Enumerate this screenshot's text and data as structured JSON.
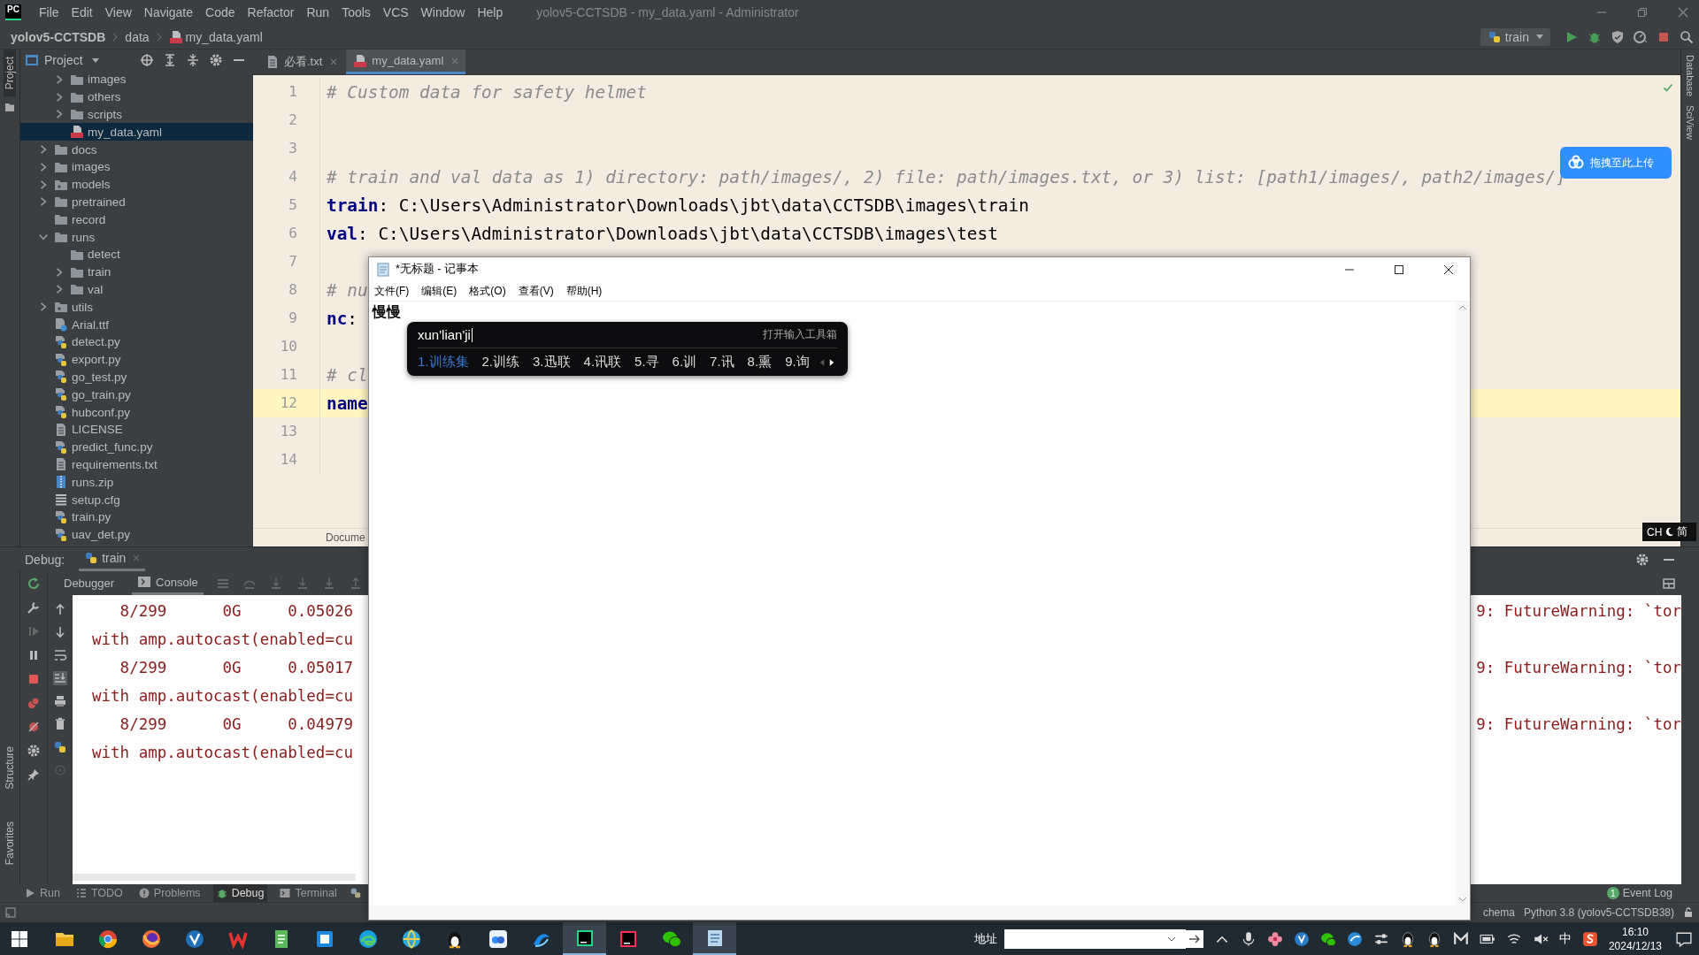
{
  "ide": {
    "logo": "PC",
    "menu": [
      "File",
      "Edit",
      "View",
      "Navigate",
      "Code",
      "Refactor",
      "Run",
      "Tools",
      "VCS",
      "Window",
      "Help"
    ],
    "window_title": "yolov5-CCTSDB - my_data.yaml - Administrator",
    "breadcrumbs": [
      {
        "label": "yolov5-CCTSDB",
        "kind": "project"
      },
      {
        "label": "data",
        "kind": "folder"
      },
      {
        "label": "my_data.yaml",
        "kind": "yaml"
      }
    ],
    "run_config": "train",
    "left_stripe": [
      "Project"
    ],
    "project_panel": {
      "title": "Project",
      "tree": [
        {
          "children": [
            {
              "name": "images",
              "kind": "folder",
              "expanded": false,
              "selected": false
            },
            {
              "name": "others",
              "kind": "folder",
              "expanded": false,
              "selected": false
            },
            {
              "name": "scripts",
              "kind": "folder",
              "expanded": false,
              "selected": false
            },
            {
              "name": "my_data.yaml",
              "kind": "yaml",
              "selected": true
            }
          ]
        },
        {
          "name": "docs",
          "kind": "folder",
          "expanded": false,
          "selected": false
        },
        {
          "name": "images",
          "kind": "folder",
          "expanded": false,
          "selected": false
        },
        {
          "name": "models",
          "kind": "package",
          "expanded": false,
          "selected": false
        },
        {
          "name": "pretrained",
          "kind": "folder",
          "expanded": false,
          "selected": false
        },
        {
          "name": "record",
          "kind": "folder",
          "selected": false
        },
        {
          "name": "runs",
          "kind": "folder",
          "expanded": true,
          "selected": false,
          "children": [
            {
              "name": "detect",
              "kind": "folder",
              "selected": false
            },
            {
              "name": "train",
              "kind": "folder",
              "expanded": false,
              "selected": false
            },
            {
              "name": "val",
              "kind": "folder",
              "expanded": false,
              "selected": false
            }
          ]
        },
        {
          "name": "utils",
          "kind": "package",
          "expanded": false,
          "selected": false
        },
        {
          "name": "Arial.ttf",
          "kind": "font",
          "selected": false
        },
        {
          "name": "detect.py",
          "kind": "py",
          "selected": false
        },
        {
          "name": "export.py",
          "kind": "py",
          "selected": false
        },
        {
          "name": "go_test.py",
          "kind": "py",
          "selected": false
        },
        {
          "name": "go_train.py",
          "kind": "py",
          "selected": false
        },
        {
          "name": "hubconf.py",
          "kind": "py",
          "selected": false
        },
        {
          "name": "LICENSE",
          "kind": "text",
          "selected": false
        },
        {
          "name": "predict_func.py",
          "kind": "py",
          "selected": false
        },
        {
          "name": "requirements.txt",
          "kind": "text",
          "selected": false
        },
        {
          "name": "runs.zip",
          "kind": "zip",
          "selected": false
        },
        {
          "name": "setup.cfg",
          "kind": "cfg",
          "selected": false
        },
        {
          "name": "train.py",
          "kind": "py",
          "selected": false
        },
        {
          "name": "uav_det.py",
          "kind": "py",
          "selected": false
        }
      ]
    },
    "editor_tabs": [
      {
        "label": "必看.txt",
        "kind": "text",
        "selected": false
      },
      {
        "label": "my_data.yaml",
        "kind": "yaml",
        "selected": true
      }
    ],
    "editor_lines": [
      {
        "number": "1",
        "kind": "comment",
        "text": "# Custom data for safety helmet",
        "current": false
      },
      {
        "number": "2",
        "current": false
      },
      {
        "number": "3",
        "current": false
      },
      {
        "number": "4",
        "kind": "comment",
        "text": "# train and val data as 1) directory: path/images/, 2) file: path/images.txt, or 3) list: [path1/images/, path2/images/]",
        "current": false
      },
      {
        "number": "5",
        "kind": "pair",
        "key": "train",
        "rest": ": C:\\Users\\Administrator\\Downloads\\jbt\\data\\CCTSDB\\images\\train",
        "current": false
      },
      {
        "number": "6",
        "kind": "pair",
        "key": "val",
        "rest": ": C:\\Users\\Administrator\\Downloads\\jbt\\data\\CCTSDB\\images\\test",
        "current": false
      },
      {
        "number": "7",
        "current": false
      },
      {
        "number": "8",
        "kind": "comment",
        "text": "# nu",
        "current": false
      },
      {
        "number": "9",
        "kind": "pair",
        "key": "nc",
        "rest": ":",
        "current": false
      },
      {
        "number": "10",
        "current": false
      },
      {
        "number": "11",
        "kind": "comment",
        "text": "# cl",
        "current": false
      },
      {
        "number": "12",
        "kind": "pair",
        "key": "name",
        "current": true
      },
      {
        "number": "13",
        "current": false
      },
      {
        "number": "14",
        "current": false
      }
    ],
    "editor_breadcrumb": "Docume",
    "right_stripe": [
      "Database",
      "SciView"
    ],
    "upload_badge": "拖拽至此上传",
    "debug": {
      "title": "Debug:",
      "session": "train",
      "tabs": [
        {
          "label": "Debugger",
          "selected": false
        },
        {
          "label": "Console",
          "selected": true
        }
      ],
      "console": [
        {
          "left": "   8/299      0G     0.05026",
          "right": "9: FutureWarning: `tor"
        },
        {
          "left": "with amp.autocast(enabled=cu"
        },
        {
          "left": "   8/299      0G     0.05017",
          "right": "9: FutureWarning: `tor"
        },
        {
          "left": "with amp.autocast(enabled=cu"
        },
        {
          "left": "   8/299      0G     0.04979",
          "right": "9: FutureWarning: `tor"
        },
        {
          "left": "with amp.autocast(enabled=cu"
        }
      ]
    },
    "side_tabs": [
      "Structure",
      "Favorites"
    ],
    "tool_tabs": [
      {
        "label": "Run",
        "kind": "run",
        "selected": false
      },
      {
        "label": "TODO",
        "kind": "todo",
        "selected": false
      },
      {
        "label": "Problems",
        "kind": "problems",
        "selected": false
      },
      {
        "label": "Debug",
        "kind": "debug",
        "selected": true
      },
      {
        "label": "Terminal",
        "kind": "terminal",
        "selected": false
      }
    ],
    "event_log": {
      "count": "1",
      "label": "Event Log"
    },
    "status": [
      "chema",
      "Python 3.8 (yolov5-CCTSDB38)"
    ]
  },
  "ime_indicator": {
    "language": "CH",
    "mode": "简"
  },
  "notepad": {
    "title": "*无标题 - 记事本",
    "menu": [
      "文件(F)",
      "编辑(E)",
      "格式(O)",
      "查看(V)",
      "帮助(H)"
    ],
    "content": "慢慢",
    "ime": {
      "composition": "xun'lian'ji",
      "toolbox": "打开输入工具箱",
      "candidates": [
        {
          "label": "1.训练集",
          "selected": true
        },
        {
          "label": "2.训练",
          "selected": false
        },
        {
          "label": "3.迅联",
          "selected": false
        },
        {
          "label": "4.讯联",
          "selected": false
        },
        {
          "label": "5.寻",
          "selected": false
        },
        {
          "label": "6.训",
          "selected": false
        },
        {
          "label": "7.讯",
          "selected": false
        },
        {
          "label": "8.熏",
          "selected": false
        },
        {
          "label": "9.询",
          "selected": false
        }
      ],
      "prev_enabled": false,
      "next_enabled": true
    }
  },
  "taskbar": {
    "apps": [
      {
        "kind": "explorer",
        "active": false
      },
      {
        "kind": "chrome",
        "active": false
      },
      {
        "kind": "firefox",
        "active": false
      },
      {
        "kind": "vapp",
        "active": false
      },
      {
        "kind": "wps",
        "active": false
      },
      {
        "kind": "greendoc",
        "active": false
      },
      {
        "kind": "bluesquare",
        "active": false
      },
      {
        "kind": "edge",
        "active": false
      },
      {
        "kind": "globe",
        "active": false
      },
      {
        "kind": "penguin",
        "active": false
      },
      {
        "kind": "cloud",
        "active": false
      },
      {
        "kind": "swirl",
        "active": false
      },
      {
        "kind": "pycharm",
        "active": true
      },
      {
        "kind": "intellij",
        "active": false
      },
      {
        "kind": "wechat",
        "active": false
      },
      {
        "kind": "notepad",
        "active": true
      }
    ],
    "address_label": "地址",
    "input_mode": "中",
    "time": "16:10",
    "date": "2024/12/13"
  }
}
